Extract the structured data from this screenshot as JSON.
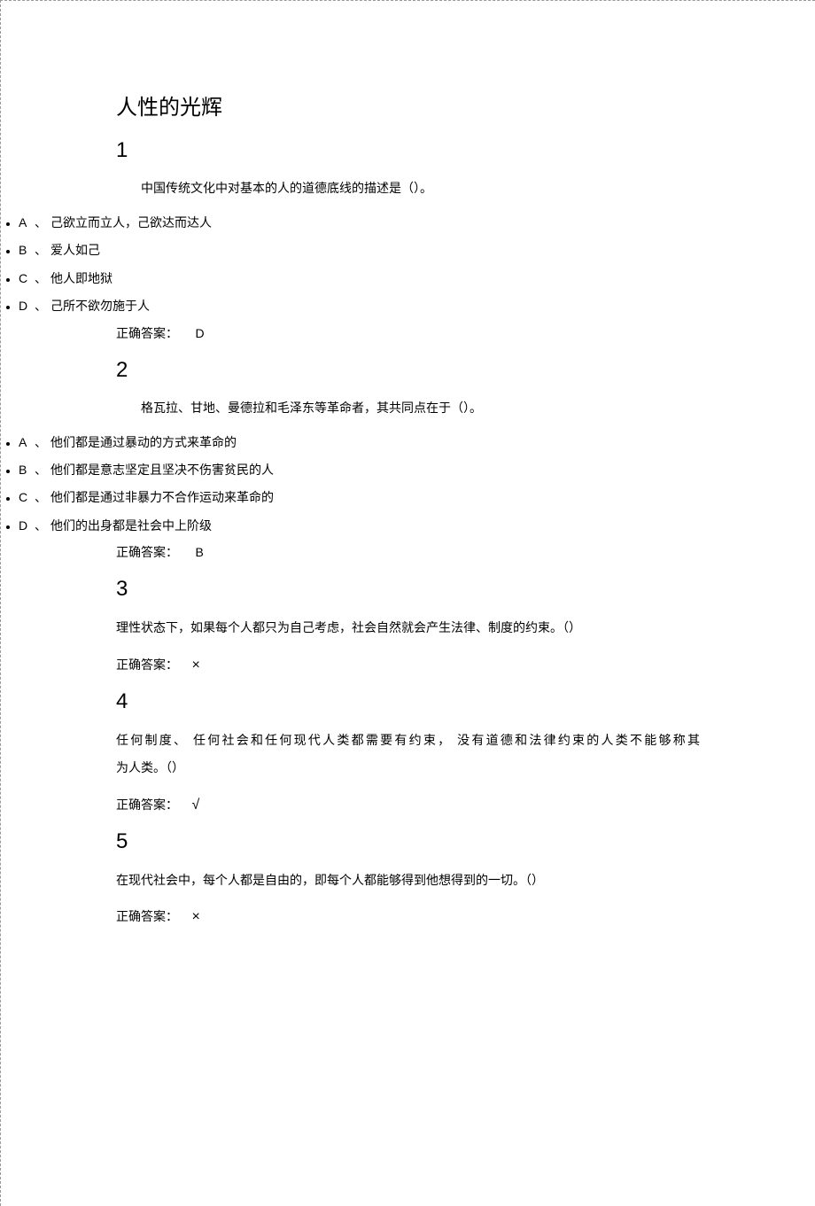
{
  "title": "人性的光辉",
  "answer_label": "正确答案：",
  "marks": {
    "wrong": "×",
    "right": "√"
  },
  "questions": [
    {
      "num": "1",
      "stem": "中国传统文化中对基本的人的道德底线的描述是（）。",
      "options": [
        {
          "label": "A",
          "text": "己欲立而立人，己欲达而达人"
        },
        {
          "label": "B",
          "text": "爱人如己"
        },
        {
          "label": "C",
          "text": "他人即地狱"
        },
        {
          "label": "D",
          "text": "己所不欲勿施于人"
        }
      ],
      "answer": "D"
    },
    {
      "num": "2",
      "stem": "格瓦拉、甘地、曼德拉和毛泽东等革命者，其共同点在于（）。",
      "options": [
        {
          "label": "A",
          "text": "他们都是通过暴动的方式来革命的"
        },
        {
          "label": "B",
          "text": "他们都是意志坚定且坚决不伤害贫民的人"
        },
        {
          "label": "C",
          "text": "他们都是通过非暴力不合作运动来革命的"
        },
        {
          "label": "D",
          "text": "他们的出身都是社会中上阶级"
        }
      ],
      "answer": "B"
    },
    {
      "num": "3",
      "stem": "理性状态下，如果每个人都只为自己考虑，社会自然就会产生法律、制度的约束。（）",
      "answer_mark": "wrong"
    },
    {
      "num": "4",
      "stem_line1": "任何制度、 任何社会和任何现代人类都需要有约束，",
      "stem_line2": "没有道德和法律约束的人类不能够称其",
      "stem_line3": "为人类。（）",
      "answer_mark": "right"
    },
    {
      "num": "5",
      "stem": "在现代社会中，每个人都是自由的，即每个人都能够得到他想得到的一切。（）",
      "answer_mark": "wrong"
    }
  ]
}
